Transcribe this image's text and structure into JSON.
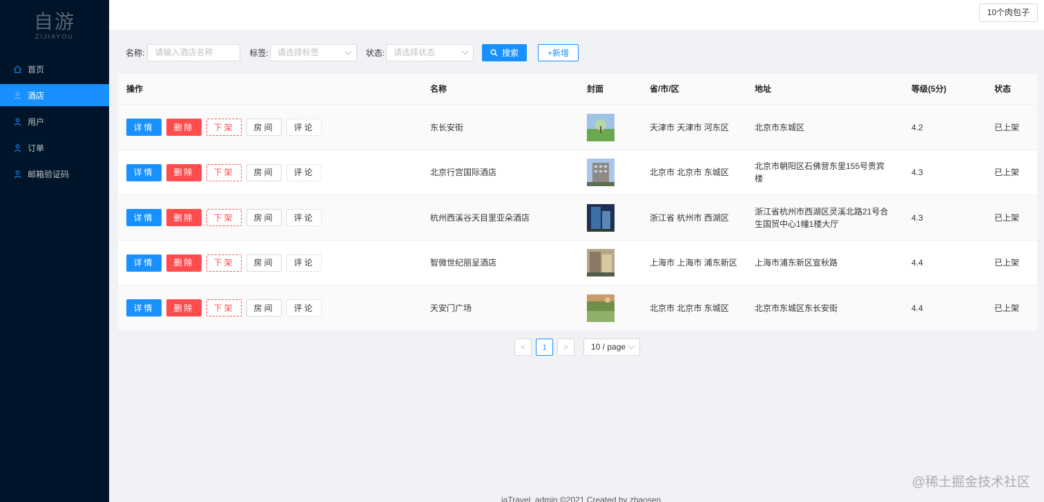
{
  "logo": {
    "main": "自游",
    "sub": "ZIJIAYOU"
  },
  "sidebar": {
    "items": [
      {
        "label": "首页",
        "icon": "home-icon",
        "active": false
      },
      {
        "label": "酒店",
        "icon": "user-icon",
        "active": true
      },
      {
        "label": "用户",
        "icon": "user-icon",
        "active": false
      },
      {
        "label": "订单",
        "icon": "user-icon",
        "active": false
      },
      {
        "label": "邮箱验证码",
        "icon": "user-icon",
        "active": false
      }
    ]
  },
  "header": {
    "user": "10个肉包子"
  },
  "search": {
    "name_label": "名称:",
    "name_placeholder": "请输入酒店名称",
    "tag_label": "标签:",
    "tag_placeholder": "请选择标签",
    "status_label": "状态:",
    "status_placeholder": "请选择状态",
    "search_button": "搜索",
    "add_button": "+新增"
  },
  "table": {
    "columns": [
      "操作",
      "名称",
      "封面",
      "省/市/区",
      "地址",
      "等级(5分)",
      "状态"
    ],
    "actions": {
      "detail": "详情",
      "delete": "删除",
      "offline": "下架",
      "rooms": "房间",
      "comments": "评论"
    },
    "rows": [
      {
        "name": "东长安街",
        "region": "天津市 天津市 河东区",
        "address": "北京市东城区",
        "rating": "4.2",
        "status": "已上架"
      },
      {
        "name": "北京行宫国际酒店",
        "region": "北京市 北京市 东城区",
        "address": "北京市朝阳区石佛营东里155号贵宾楼",
        "rating": "4.3",
        "status": "已上架"
      },
      {
        "name": "杭州西溪谷天目里亚朵酒店",
        "region": "浙江省 杭州市 西湖区",
        "address": "浙江省杭州市西湖区灵溪北路21号合生国贸中心1幢1楼大厅",
        "rating": "4.3",
        "status": "已上架"
      },
      {
        "name": "智微世纪丽呈酒店",
        "region": "上海市 上海市 浦东新区",
        "address": "上海市浦东新区宣秋路",
        "rating": "4.4",
        "status": "已上架"
      },
      {
        "name": "天安门广场",
        "region": "北京市 北京市 东城区",
        "address": "北京市东城区东长安街",
        "rating": "4.4",
        "status": "已上架"
      }
    ]
  },
  "pagination": {
    "prev": "<",
    "current": "1",
    "next": ">",
    "page_size": "10 / page"
  },
  "footer": "iaTravel_admin ©2021 Created by zhaosen",
  "watermark": "@稀土掘金技术社区",
  "colors": {
    "primary": "#1890ff",
    "danger": "#ff4d4f",
    "sider": "#001529"
  }
}
